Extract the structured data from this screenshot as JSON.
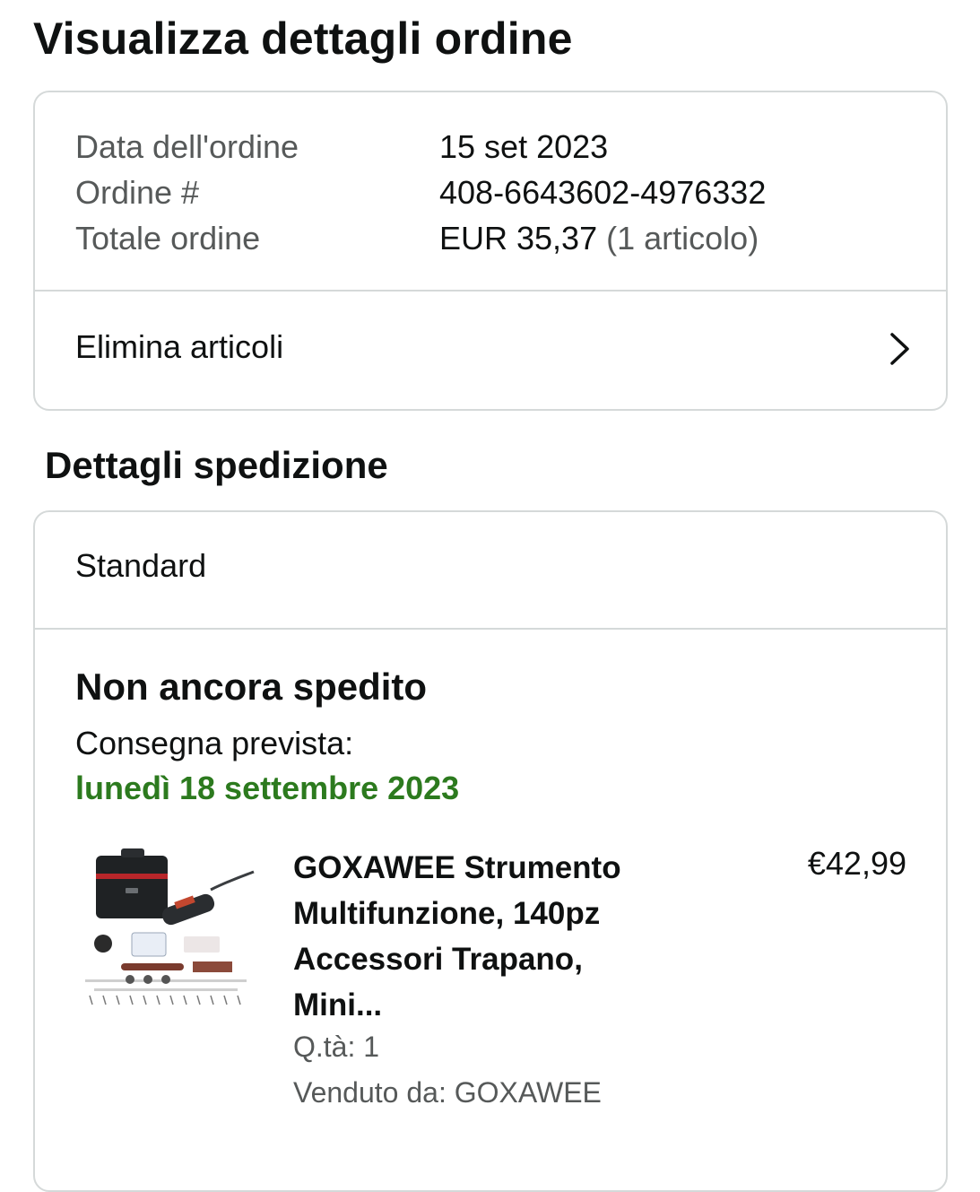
{
  "page": {
    "title": "Visualizza dettagli ordine"
  },
  "order": {
    "date_label": "Data dell'ordine",
    "date_value": "15 set 2023",
    "number_label": "Ordine #",
    "number_value": "408-6643602-4976332",
    "total_label": "Totale ordine",
    "total_value": "EUR 35,37",
    "total_items": "(1 articolo)",
    "delete_items_label": "Elimina articoli"
  },
  "shipping": {
    "section_title": "Dettagli spedizione",
    "method": "Standard",
    "status": "Non ancora spedito",
    "eta_label": "Consegna prevista:",
    "eta_date": "lunedì 18 settembre 2023",
    "eta_color": "#2c7a1e",
    "item": {
      "title_lines": [
        "GOXAWEE Strumento",
        "Multifunzione, 140pz",
        "Accessori Trapano,",
        "Mini..."
      ],
      "price": "€42,99",
      "qty": "Q.tà: 1",
      "seller": "Venduto da: GOXAWEE"
    }
  },
  "icons": {
    "chevron": "chevron-right-icon"
  }
}
